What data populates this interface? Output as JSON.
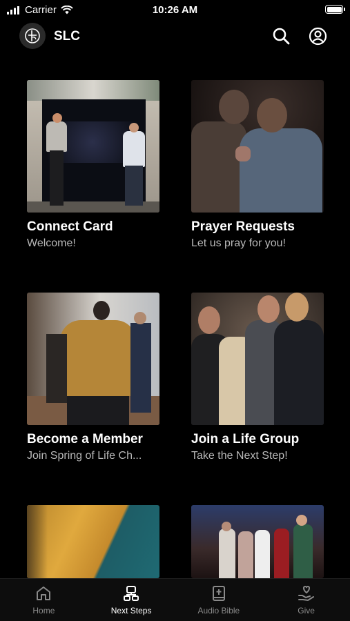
{
  "status_bar": {
    "carrier": "Carrier",
    "time": "10:26 AM"
  },
  "header": {
    "title": "SLC"
  },
  "cards": [
    {
      "title": "Connect Card",
      "subtitle": "Welcome!"
    },
    {
      "title": "Prayer Requests",
      "subtitle": "Let us pray for you!"
    },
    {
      "title": "Become a Member",
      "subtitle": "Join Spring of Life Ch..."
    },
    {
      "title": "Join a Life Group",
      "subtitle": "Take the Next Step!"
    },
    {
      "title": "",
      "subtitle": ""
    },
    {
      "title": "",
      "subtitle": ""
    }
  ],
  "tabs": [
    {
      "label": "Home",
      "icon": "home-icon",
      "active": false
    },
    {
      "label": "Next Steps",
      "icon": "next-steps-icon",
      "active": true
    },
    {
      "label": "Audio Bible",
      "icon": "bible-icon",
      "active": false
    },
    {
      "label": "Give",
      "icon": "give-icon",
      "active": false
    }
  ]
}
